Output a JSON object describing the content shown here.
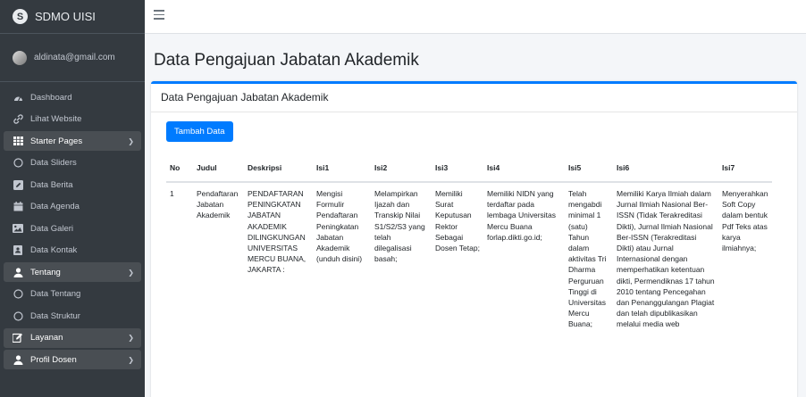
{
  "brand": {
    "name": "SDMO UISI"
  },
  "user": {
    "email": "aldinata@gmail.com"
  },
  "sidebar": {
    "items": [
      {
        "label": "Dashboard",
        "icon": "dashboard-icon"
      },
      {
        "label": "Lihat Website",
        "icon": "link-icon"
      },
      {
        "label": "Starter Pages",
        "icon": "grid-icon"
      },
      {
        "label": "Data Sliders",
        "icon": "circle-icon"
      },
      {
        "label": "Data Berita",
        "icon": "pen-icon"
      },
      {
        "label": "Data Agenda",
        "icon": "calendar-icon"
      },
      {
        "label": "Data Galeri",
        "icon": "image-icon"
      },
      {
        "label": "Data Kontak",
        "icon": "contact-icon"
      },
      {
        "label": "Tentang",
        "icon": "user-icon"
      },
      {
        "label": "Data Tentang",
        "icon": "circle-icon"
      },
      {
        "label": "Data Struktur",
        "icon": "circle-icon"
      },
      {
        "label": "Layanan",
        "icon": "edit-icon"
      },
      {
        "label": "Profil Dosen",
        "icon": "user-icon"
      }
    ]
  },
  "page": {
    "title": "Data Pengajuan Jabatan Akademik"
  },
  "card": {
    "title": "Data Pengajuan Jabatan Akademik",
    "add_button": "Tambah Data"
  },
  "table": {
    "headers": [
      "No",
      "Judul",
      "Deskripsi",
      "Isi1",
      "Isi2",
      "Isi3",
      "Isi4",
      "Isi5",
      "Isi6",
      "Isi7"
    ],
    "rows": [
      {
        "cells": [
          "1",
          "Pendaftaran Jabatan Akademik",
          "PENDAFTARAN PENINGKATAN JABATAN AKADEMIK DILINGKUNGAN UNIVERSITAS MERCU BUANA, JAKARTA :",
          "Mengisi Formulir Pendaftaran Peningkatan Jabatan Akademik (unduh disini)",
          "Melampirkan Ijazah dan Transkip Nilai S1/S2/S3 yang telah dilegalisasi basah;",
          "Memiliki Surat Keputusan Rektor Sebagai Dosen Tetap;",
          "Memiliki NIDN yang terdaftar pada lembaga Universitas Mercu Buana forlap.dikti.go.id;",
          "Telah mengabdi minimal 1 (satu) Tahun dalam aktivitas Tri Dharma Perguruan Tinggi di Universitas Mercu Buana;",
          "Memiliki Karya Ilmiah dalam Jurnal Ilmiah Nasional Ber-ISSN (Tidak Terakreditasi Dikti), Jurnal Ilmiah Nasional Ber-ISSN (Terakreditasi Dikti) atau Jurnal Internasional dengan memperhatikan ketentuan dikti, Permendiknas 17 tahun 2010 tentang Pencegahan dan Penanggulangan Plagiat dan telah dipublikasikan melalui media web",
          "Menyerahkan Soft Copy dalam bentuk Pdf Teks atas karya ilmiahnya;"
        ]
      }
    ]
  }
}
